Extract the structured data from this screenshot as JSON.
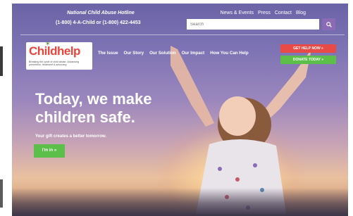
{
  "hotline": {
    "title": "National Child Abuse Hotline",
    "numbers": "(1-800) 4-A-Child or (1-800) 422-4453"
  },
  "top_links": [
    "News & Events",
    "Press",
    "Contact",
    "Blog"
  ],
  "search": {
    "placeholder": "Search"
  },
  "logo": {
    "name": "Childhelp",
    "tagline": "Breaking the cycle of child abuse. Advancing prevention, treatment & advocacy."
  },
  "nav": [
    "The Issue",
    "Our Story",
    "Our Solution",
    "Our Impact",
    "How You Can Help"
  ],
  "buttons": {
    "get_help": "GET HELP NOW »",
    "donate": "DONATE TODAY »",
    "cta": "I'm in »"
  },
  "hero": {
    "headline": "Today, we make\nchildren safe.",
    "subline": "Your gift creates a better tomorrow."
  },
  "colors": {
    "accent_red": "#e84b45",
    "accent_green": "#5bbf4a",
    "brand_purple": "#8b6bb5"
  }
}
